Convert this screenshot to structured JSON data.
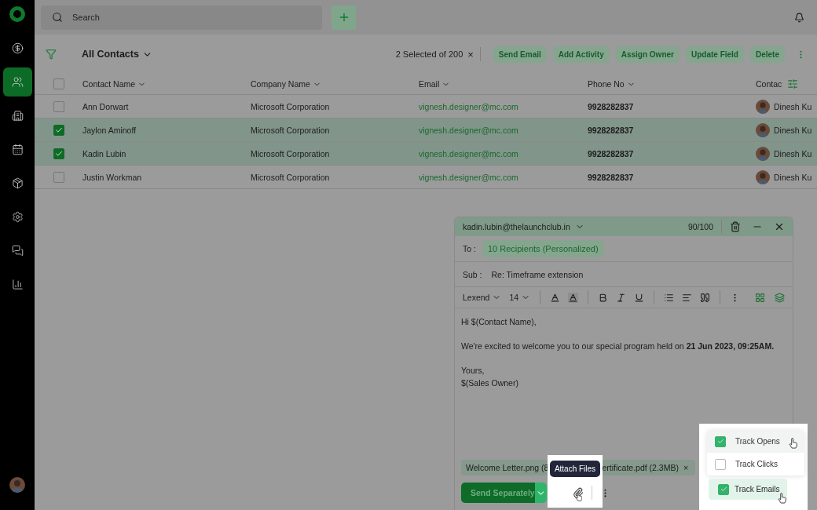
{
  "sidebar": {
    "items": [
      {
        "selected": false
      },
      {
        "selected": true
      },
      {
        "selected": false
      },
      {
        "selected": false
      },
      {
        "selected": false
      },
      {
        "selected": false
      },
      {
        "selected": false
      },
      {
        "selected": false
      }
    ]
  },
  "topbar": {
    "search": {
      "placeholder": "Search"
    }
  },
  "list": {
    "title": "All Contacts",
    "selection": "2 Selected of 200",
    "clear": "×",
    "actions": [
      "Send Email",
      "Add Activity",
      "Assign Owner",
      "Update Field",
      "Delete"
    ]
  },
  "table": {
    "header_checked": false,
    "columns": [
      "Contact Name",
      "Company Name",
      "Email",
      "Phone No",
      "Contac"
    ],
    "rows": [
      {
        "selected": false,
        "checked": false,
        "name": "Ann Dorwart",
        "company": "Microsoft Corporation",
        "email": "vignesh.designer@mc.com",
        "phone": "9928282837",
        "owner": "Dinesh Ku"
      },
      {
        "selected": true,
        "checked": true,
        "name": "Jaylon Aminoff",
        "company": "Microsoft Corporation",
        "email": "vignesh.designer@mc.com",
        "phone": "9928282837",
        "owner": "Dinesh Ku"
      },
      {
        "selected": true,
        "checked": true,
        "name": "Kadin Lubin",
        "company": "Microsoft Corporation",
        "email": "vignesh.designer@mc.com",
        "phone": "9928282837",
        "owner": "Dinesh Ku"
      },
      {
        "selected": false,
        "checked": false,
        "name": "Justin Workman",
        "company": "Microsoft Corporation",
        "email": "vignesh.designer@mc.com",
        "phone": "9928282837",
        "owner": "Dinesh Ku"
      }
    ]
  },
  "composer": {
    "from": "kadin.lubin@thelaunchclub.in",
    "counter": "90/100",
    "to_label": "To :",
    "recipients": "10 Recipients (Personalized)",
    "subject_label": "Sub :",
    "subject": "Re: Timeframe extension",
    "font": "Lexend",
    "size": "14",
    "body": [
      "Hi $(Contact Name),",
      "We're excited to welcome you to our special program held on **21 Jun 2023, 09:25AM.**",
      "Yours,",
      "$(Sales Owner)"
    ],
    "attachments": [
      "Welcome Letter.png (8",
      "ertificate.pdf (2.3MB)"
    ],
    "attachment_close": "×",
    "send": "Send Separately",
    "tooltip": "Attach Files"
  },
  "tracking": {
    "options": [
      {
        "label": "Track Opens",
        "checked": true,
        "selected": true
      },
      {
        "label": "Track Clicks",
        "checked": false,
        "selected": false
      }
    ],
    "toggle": {
      "label": "Track Emails",
      "checked": true
    }
  }
}
